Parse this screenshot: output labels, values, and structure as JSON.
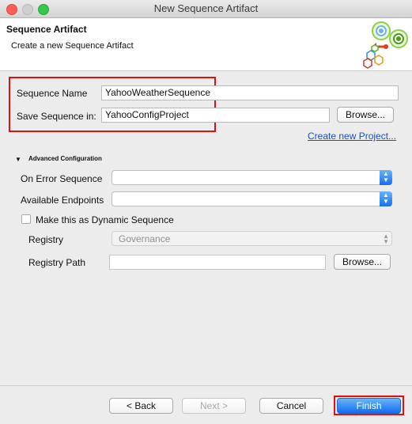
{
  "window": {
    "title": "New Sequence Artifact"
  },
  "banner": {
    "title": "Sequence Artifact",
    "subtitle": "Create a new Sequence Artifact"
  },
  "form": {
    "sequence_name_label": "Sequence Name",
    "sequence_name_value": "YahooWeatherSequence",
    "save_in_label": "Save Sequence in:",
    "save_in_value": "YahooConfigProject",
    "browse_label": "Browse...",
    "create_project_link": "Create new Project..."
  },
  "advanced": {
    "section_label": "Advanced Configuration",
    "on_error_label": "On Error Sequence",
    "on_error_value": "",
    "endpoints_label": "Available Endpoints",
    "endpoints_value": "",
    "dynamic_label": "Make this as Dynamic Sequence",
    "dynamic_checked": false,
    "registry_label": "Registry",
    "registry_value": "Governance",
    "registry_path_label": "Registry Path",
    "registry_path_value": "",
    "browse_label": "Browse..."
  },
  "footer": {
    "back": "< Back",
    "next": "Next >",
    "cancel": "Cancel",
    "finish": "Finish"
  },
  "colors": {
    "accent": "#1470ef",
    "highlight": "#e01010"
  }
}
